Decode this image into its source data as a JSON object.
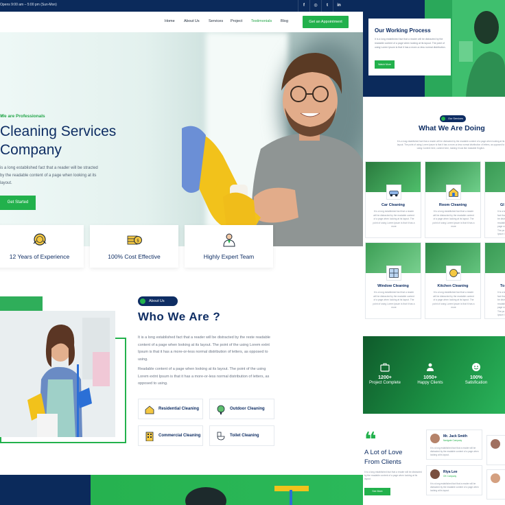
{
  "topbar": {
    "hours": "Opens 9:00 am – 5:00 pm (Sun-Mon)",
    "social": [
      "f",
      "◎",
      "t",
      "in"
    ]
  },
  "nav": {
    "items": [
      "Home",
      "About Us",
      "Services",
      "Project",
      "Testimonials",
      "Blog"
    ],
    "active": "Testimonials",
    "cta": "Get an Appointment"
  },
  "hero": {
    "tagline": "We are Professionals",
    "title_line1": "Cleaning Services",
    "title_line2": "Company",
    "description": "is a long established fact that a reader will be stracted by the readable content of a page when looking at its layout.",
    "button": "Get Started"
  },
  "features": [
    {
      "label": "12 Years of Experience",
      "icon": "medal-icon"
    },
    {
      "label": "100% Cost Effective",
      "icon": "money-icon"
    },
    {
      "label": "Highly Expert Team",
      "icon": "team-icon"
    }
  ],
  "about": {
    "badge": "About Us",
    "title": "Who We Are ?",
    "para1": "It is a long established fact that a reader will be distracted by the reste readable content of a page when looking at its layout. The point of the using Lorem extnt Ipsum is that it has a more-or-less normal distribution of letters, as opposed to using.",
    "para2": "Readable content of a page when looking at its layout. The point of the using Lorem extnt Ipsum is that it has a more-or-less normal distribution of letters, as opposed to using.",
    "services": [
      "Residential Cleaning",
      "Outdoor Cleaning",
      "Commercial Cleaning",
      "Toilet Cleaning"
    ]
  },
  "process": {
    "title": "Our Working Process",
    "description": "It is a long established fact that a reader will be distracted by the readable content of a page when looking at its layout. The point of using Lorem Ipsum is that it has a more-or-less normal distribution.",
    "button": "Watch More"
  },
  "services": {
    "badge": "Our Services",
    "title": "What We Are Doing",
    "description": "It is a long established fact that a reader will be distracted by the readable content of a page when looking at its layout. The point of using Lorem Ipsum is that it has a more-or-less normal distribution of letters, as opposed to using Content here, content here, making it look like readable English.",
    "cards": [
      {
        "title": "Car Cleaning",
        "desc": "It is a long established fact that a reader will be distracted by the readable content of a page when looking at its layout. The point of using Lorem Ipsum is that it has a more"
      },
      {
        "title": "Room Cleaning",
        "desc": "It is a long established fact that a reader will be distracted by the readable content of a page when looking at its layout. The point of using Lorem Ipsum is that it has a more"
      },
      {
        "title": "Gl",
        "desc": "It is a lo fact tha be distr readabl page w The po Ipsum i"
      },
      {
        "title": "Window Cleaning",
        "desc": "It is a long established fact that a reader will be distracted by the readable content of a page when looking at its layout. The point of using Lorem Ipsum is that it has a more"
      },
      {
        "title": "Kitchen Cleaning",
        "desc": "It is a long established fact that a reader will be distracted by the readable content of a page when looking at its layout. The point of using Lorem Ipsum is that it has a more"
      },
      {
        "title": "To",
        "desc": "It is a lo fact tha be distr readabl page w The po Ipsum i"
      }
    ]
  },
  "stats": [
    {
      "num": "1200+",
      "label": "Project Complete"
    },
    {
      "num": "1050+",
      "label": "Happy Clients"
    },
    {
      "num": "100%",
      "label": "Satisfication"
    }
  ],
  "testimonials": {
    "title_line1": "A Lot of Love",
    "title_line2": "From Clients",
    "description": "It is a long established fact that a reader will be distracted by the readable content of a page when looking at its layout.",
    "button": "See More",
    "cards": [
      {
        "name": "Mr. Jack Smith",
        "company": "Navigate Company",
        "quote": "It is a long established fact that a reader will be distracted by the readable content of a page when looking at its layout."
      },
      {
        "name": "Riya Lee",
        "company": "OK Company",
        "quote": "It is a long established fact that a reader will be distracted by the readable content of a page when looking at its layout."
      }
    ]
  },
  "colors": {
    "navy": "#0e2d63",
    "green": "#22b14c",
    "topbar": "#0b2a5b"
  }
}
